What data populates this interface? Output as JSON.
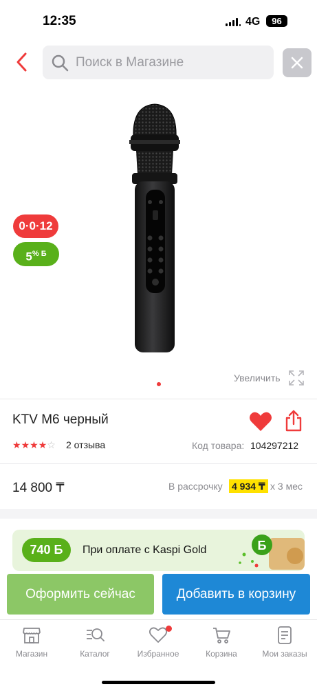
{
  "status_bar": {
    "time": "12:35",
    "network": "4G",
    "battery": "96"
  },
  "header": {
    "search_placeholder": "Поиск в Магазине"
  },
  "gallery": {
    "badge_installment": "0·0·12",
    "badge_bonus_value": "5",
    "badge_bonus_suffix": "% Б",
    "zoom_label": "Увеличить",
    "slide_count": 1
  },
  "product": {
    "title": "KTV M6 черный",
    "rating": 4,
    "rating_max": 5,
    "reviews": "2 отзыва",
    "code_label": "Код товара:",
    "code_value": "104297212",
    "price": "14 800 ₸",
    "installment_label": "В рассрочку",
    "installment_amount": "4 934 ₸",
    "installment_term": "x 3 мес"
  },
  "gold_banner": {
    "bonus": "740 Б",
    "text": "При оплате с Kaspi Gold"
  },
  "actions": {
    "buy_now": "Оформить сейчас",
    "add_to_cart": "Добавить в корзину"
  },
  "tabs": [
    {
      "label": "Магазин",
      "icon": "shop-icon"
    },
    {
      "label": "Каталог",
      "icon": "catalog-icon"
    },
    {
      "label": "Избранное",
      "icon": "heart-outline-icon",
      "has_notification": true
    },
    {
      "label": "Корзина",
      "icon": "cart-icon"
    },
    {
      "label": "Мои заказы",
      "icon": "orders-icon"
    }
  ],
  "colors": {
    "accent_red": "#ef3b3b",
    "bonus_green": "#59b01a",
    "buy_now_green": "#8cc766",
    "cart_blue": "#1e88d6",
    "highlight_yellow": "#ffe100"
  }
}
